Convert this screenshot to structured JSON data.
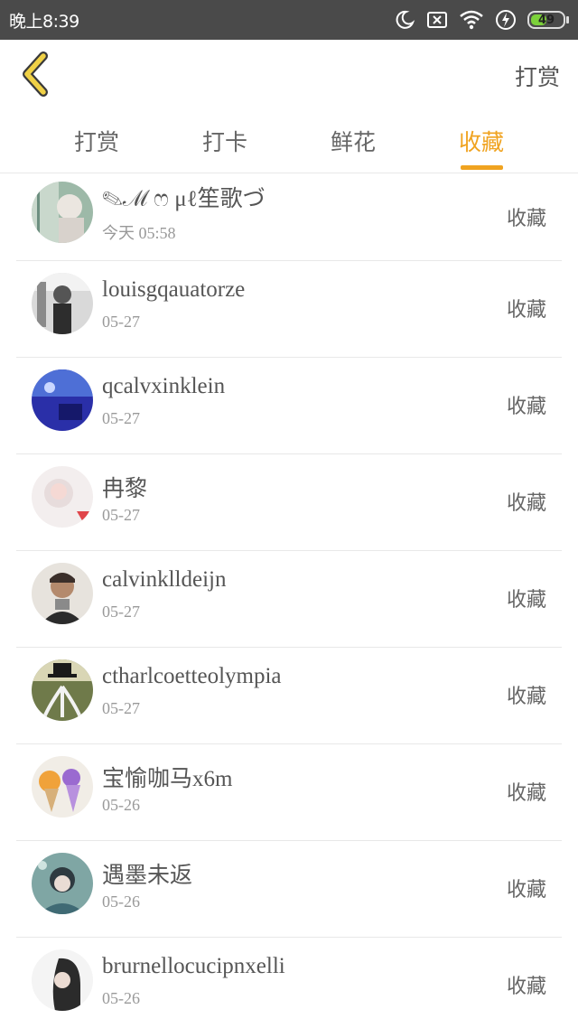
{
  "status_bar": {
    "time": "晚上8:39",
    "battery": "49",
    "battery_level": 0.49,
    "battery_color": "#7cd13a",
    "icons": [
      "moon-icon",
      "no-sim-icon",
      "wifi-icon",
      "charging-icon",
      "battery-icon"
    ]
  },
  "header": {
    "back_icon": "chevron-left-icon",
    "back_color": "#f0d146",
    "action_label": "打赏"
  },
  "tabs": [
    {
      "label": "打赏",
      "active": false
    },
    {
      "label": "打卡",
      "active": false
    },
    {
      "label": "鲜花",
      "active": false
    },
    {
      "label": "收藏",
      "active": true
    }
  ],
  "accent_color": "#f0a320",
  "list": [
    {
      "name": "✎ℳ ෆ  μℓ笙歌づ",
      "date": "今天  05:58",
      "action": "收藏"
    },
    {
      "name": "louisgqauatorze",
      "date": "05-27",
      "action": "收藏"
    },
    {
      "name": "qcalvxinklein",
      "date": "05-27",
      "action": "收藏"
    },
    {
      "name": "冉黎",
      "date": "05-27",
      "action": "收藏"
    },
    {
      "name": "calvinklldeijn",
      "date": "05-27",
      "action": "收藏"
    },
    {
      "name": "ctharlcoetteolympia",
      "date": "05-27",
      "action": "收藏"
    },
    {
      "name": "宝愉咖马x6m",
      "date": "05-26",
      "action": "收藏"
    },
    {
      "name": "遇墨未返",
      "date": "05-26",
      "action": "收藏"
    },
    {
      "name": "brurnellocucipnxelli",
      "date": "05-26",
      "action": "收藏"
    }
  ]
}
